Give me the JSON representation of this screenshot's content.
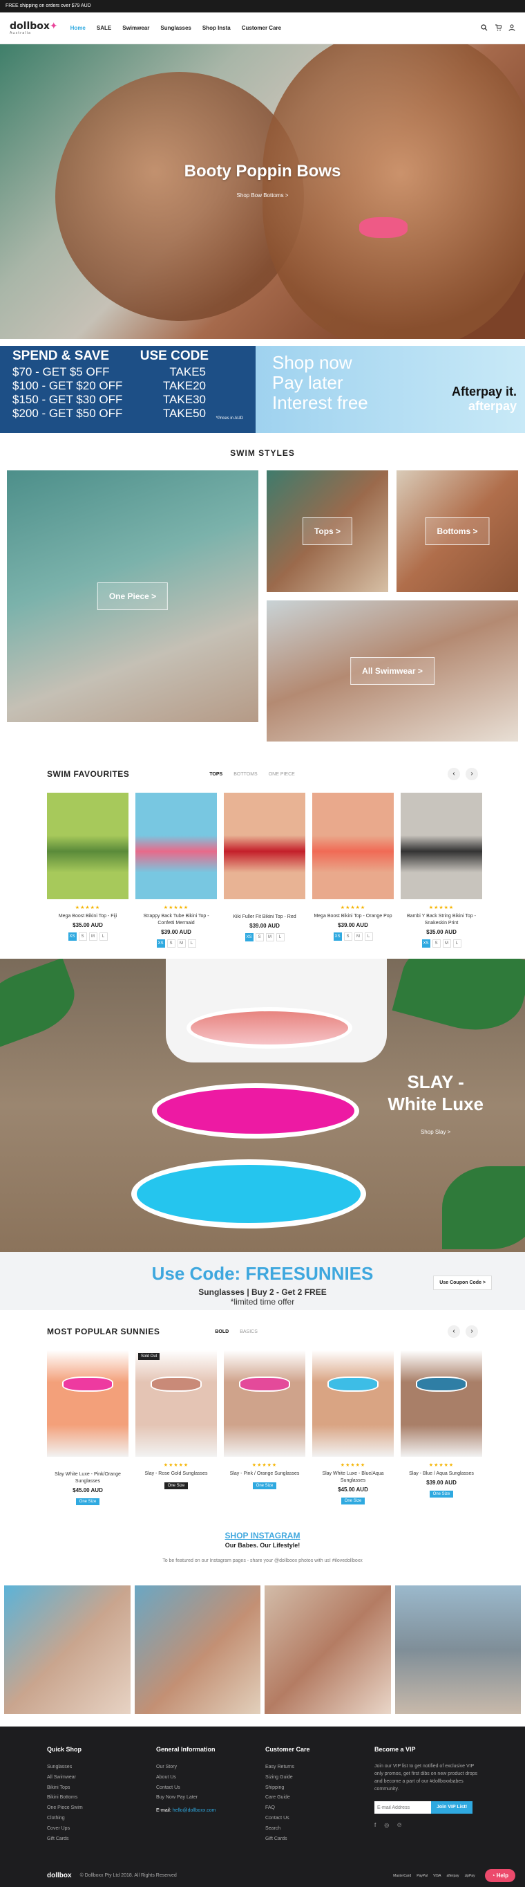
{
  "topbar": {
    "text": "FREE shipping on orders over $79 AUD"
  },
  "brand": {
    "logo": "dollbox",
    "tagline": "Australia"
  },
  "nav": {
    "items": [
      "Home",
      "SALE",
      "Swimwear",
      "Sunglasses",
      "Shop Insta",
      "Customer Care"
    ],
    "icons": [
      "search-icon",
      "cart-icon",
      "user-icon"
    ]
  },
  "hero": {
    "title": "Booty Poppin Bows",
    "link": "Shop Bow Bottoms >"
  },
  "promo": {
    "left_heads": [
      "SPEND & SAVE",
      "USE CODE"
    ],
    "rows": [
      [
        "$70 - GET $5 OFF",
        "TAKE5"
      ],
      [
        "$100 - GET $20 OFF",
        "TAKE20"
      ],
      [
        "$150 - GET $30 OFF",
        "TAKE30"
      ],
      [
        "$200 - GET $50 OFF",
        "TAKE50"
      ]
    ],
    "note": "*Prices in AUD",
    "right_lines": [
      "Shop now",
      "Pay later",
      "Interest free"
    ],
    "afterpay_tag": "Afterpay it.",
    "afterpay_logo": "afterpay"
  },
  "swim_styles": {
    "title": "SWIM STYLES",
    "tiles": [
      "One Piece >",
      "Tops >",
      "Bottoms >",
      "All Swimwear >"
    ]
  },
  "favourites": {
    "title": "SWIM FAVOURITES",
    "tabs": [
      "TOPS",
      "BOTTOMS",
      "ONE PIECE"
    ],
    "stars": "★★★★★",
    "products": [
      {
        "name": "Mega Boost Bikini Top - Fiji",
        "price": "$35.00 AUD",
        "sizes": [
          "XS",
          "S",
          "M",
          "L"
        ],
        "rated": true,
        "colors": [
          "#5a8a3a",
          "#a7c95b"
        ]
      },
      {
        "name": "Strappy Back Tube Bikini Top - Confetti Mermaid",
        "price": "$39.00 AUD",
        "sizes": [
          "XS",
          "S",
          "M",
          "L"
        ],
        "rated": true,
        "colors": [
          "#e86a8a",
          "#78c7e1"
        ]
      },
      {
        "name": "Kiki Fuller Fit Bikini Top - Red",
        "price": "$39.00 AUD",
        "sizes": [
          "XS",
          "S",
          "M",
          "L"
        ],
        "rated": false,
        "colors": [
          "#c41f2a",
          "#e8b394"
        ]
      },
      {
        "name": "Mega Boost Bikini Top - Orange Pop",
        "price": "$39.00 AUD",
        "sizes": [
          "XS",
          "S",
          "M",
          "L"
        ],
        "rated": true,
        "colors": [
          "#f06a55",
          "#e9a98c"
        ]
      },
      {
        "name": "Bambi Y Back String Bikini Top - Snakeskin Print",
        "price": "$35.00 AUD",
        "sizes": [
          "XS",
          "S",
          "M",
          "L"
        ],
        "rated": true,
        "colors": [
          "#333333",
          "#c8c4bd"
        ]
      }
    ]
  },
  "slay": {
    "title_line1": "SLAY -",
    "title_line2": "White Luxe",
    "link": "Shop Slay >"
  },
  "coupon": {
    "code_text": "Use Code: FREESUNNIES",
    "line1": "Sunglasses | Buy 2 - Get 2 FREE",
    "line2": "*limited time offer",
    "button": "Use Coupon Code >"
  },
  "sunnies": {
    "title": "MOST POPULAR SUNNIES",
    "tabs": [
      "BOLD",
      "BASICS"
    ],
    "products": [
      {
        "name": "Slay White Luxe - Pink/Orange Sunglasses",
        "price": "$45.00 AUD",
        "badge": "One Size",
        "sold_out": false,
        "rated": false,
        "colors": [
          "#ee3aa0",
          "#f3a07a"
        ]
      },
      {
        "name": "Slay - Rose Gold Sunglasses",
        "price": "",
        "badge": "One Size",
        "sold_out": true,
        "rated": true,
        "colors": [
          "#c98a78",
          "#e4c4b4"
        ]
      },
      {
        "name": "Slay - Pink / Orange Sunglasses",
        "price": "",
        "badge": "One Size",
        "sold_out": false,
        "rated": true,
        "colors": [
          "#e44a9a",
          "#cfa38b"
        ]
      },
      {
        "name": "Slay White Luxe - Blue/Aqua Sunglasses",
        "price": "$45.00 AUD",
        "badge": "One Size",
        "sold_out": false,
        "rated": true,
        "colors": [
          "#3dbde6",
          "#d9a483"
        ]
      },
      {
        "name": "Slay - Blue / Aqua Sunglasses",
        "price": "$39.00 AUD",
        "badge": "One Size",
        "sold_out": false,
        "rated": true,
        "colors": [
          "#2f7ea5",
          "#a97f68"
        ]
      }
    ],
    "sold_out_label": "Sold Out"
  },
  "instagram": {
    "title": "SHOP INSTAGRAM",
    "subtitle": "Our Babes. Our Lifestyle!",
    "note": "To be featured on our Instagram pages - share your @dollboox photos with us! #ilovedollboxx"
  },
  "footer": {
    "quick_shop": {
      "title": "Quick Shop",
      "items": [
        "Sunglasses",
        "All Swimwear",
        "Bikini Tops",
        "Bikini Bottoms",
        "One Piece Swim",
        "Clothing",
        "Cover Ups",
        "Gift Cards"
      ]
    },
    "general": {
      "title": "General Information",
      "items": [
        "Our Story",
        "About Us",
        "Contact Us",
        "Buy Now Pay Later"
      ],
      "email_label": "E-mail:",
      "email": "hello@dollboxx.com"
    },
    "care": {
      "title": "Customer Care",
      "items": [
        "Easy Returns",
        "Sizing Guide",
        "Shipping",
        "Care Guide",
        "FAQ",
        "Contact Us",
        "Search",
        "Gift Cards"
      ]
    },
    "vip": {
      "title": "Become a VIP",
      "text": "Join our VIP list to get notified of exclusive VIP only promos, get first dibs on new product drops and become a part of our #dollboxxbabes community.",
      "placeholder": "E-mail Address",
      "button": "Join VIP List!",
      "social": [
        "f",
        "◎",
        "℗"
      ]
    },
    "copyright": "© Dollboxx Pty Ltd 2018. All Rights Reserved",
    "payments": [
      "MasterCard",
      "PayPal",
      "VISA",
      "afterpay",
      "zipPay"
    ],
    "help": "Help"
  }
}
